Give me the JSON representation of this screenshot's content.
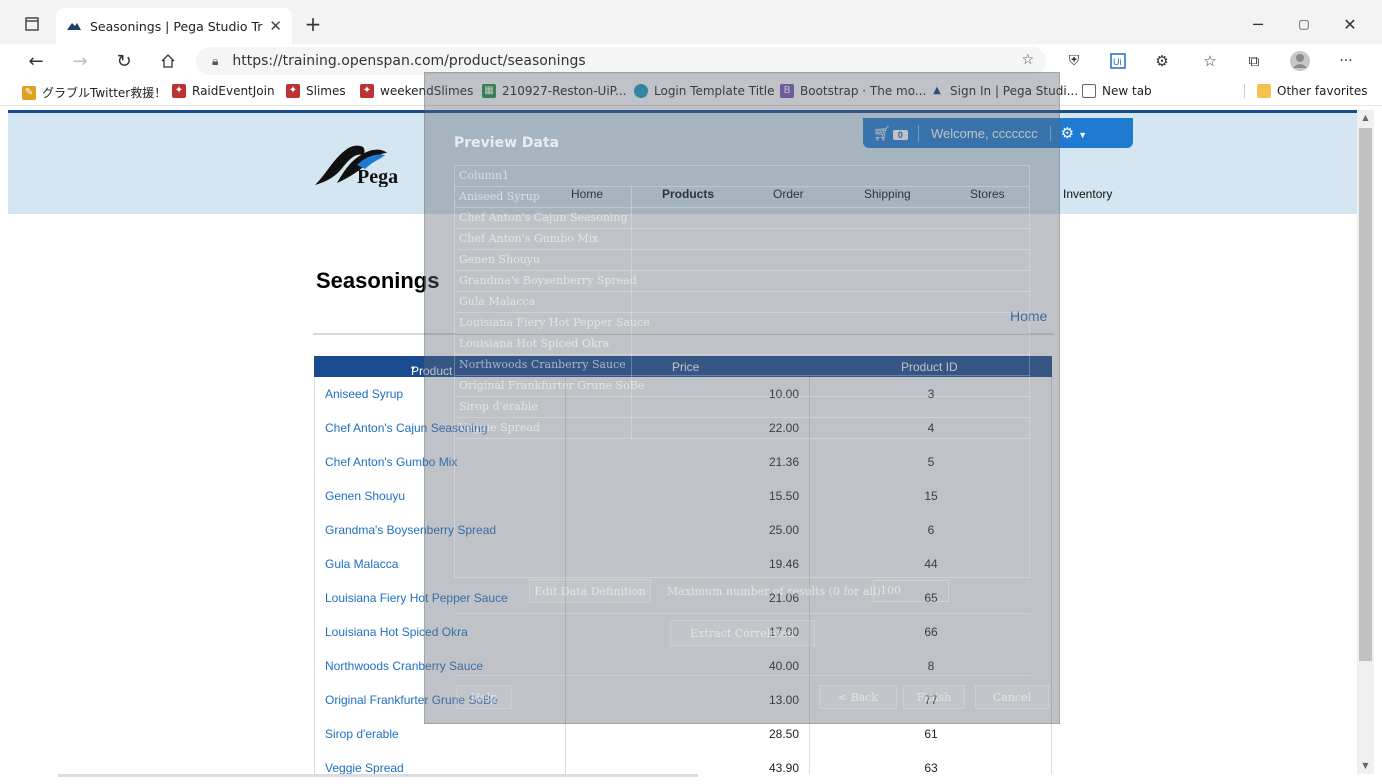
{
  "browser": {
    "tab_title": "Seasonings | Pega Studio Training",
    "url": "https://training.openspan.com/product/seasonings",
    "favorites": [
      {
        "label": "グラブルTwitter救援！",
        "icon": "pencil-icon",
        "color": "#e0a020"
      },
      {
        "label": "RaidEventJoin",
        "icon": "raid-icon",
        "color": "#b33"
      },
      {
        "label": "Slimes",
        "icon": "raid-icon",
        "color": "#b33"
      },
      {
        "label": "weekendSlimes",
        "icon": "raid-icon",
        "color": "#b33"
      },
      {
        "label": "210927-Reston-UiP...",
        "icon": "sheets-icon",
        "color": "#1e8e3e"
      },
      {
        "label": "Login Template Title",
        "icon": "salesforce-icon",
        "color": "#1798c1"
      },
      {
        "label": "Bootstrap · The mo...",
        "icon": "bootstrap-icon",
        "color": "#7952b3"
      },
      {
        "label": "Sign In | Pega Studi...",
        "icon": "pega-icon",
        "color": "#1d3d6b"
      },
      {
        "label": "New tab",
        "icon": "page-icon",
        "color": "#555"
      }
    ],
    "other_favorites": "Other favorites"
  },
  "site": {
    "brand": "Pega",
    "nav": [
      "Home",
      "Products",
      "Order",
      "Shipping",
      "Stores",
      "Inventory"
    ],
    "active_nav": "Products",
    "cart_count": "0",
    "welcome": "Welcome, ccccccc"
  },
  "main": {
    "title": "Seasonings",
    "home_link": "Home",
    "columns": [
      "Product",
      "Price",
      "Product ID"
    ],
    "rows": [
      {
        "name": "Aniseed Syrup",
        "price": "10.00",
        "id": "3"
      },
      {
        "name": "Chef Anton's Cajun Seasoning",
        "price": "22.00",
        "id": "4"
      },
      {
        "name": "Chef Anton's Gumbo Mix",
        "price": "21.36",
        "id": "5"
      },
      {
        "name": "Genen Shouyu",
        "price": "15.50",
        "id": "15"
      },
      {
        "name": "Grandma's Boysenberry Spread",
        "price": "25.00",
        "id": "6"
      },
      {
        "name": "Gula Malacca",
        "price": "19.46",
        "id": "44"
      },
      {
        "name": "Louisiana Fiery Hot Pepper Sauce",
        "price": "21.06",
        "id": "65"
      },
      {
        "name": "Louisiana Hot Spiced Okra",
        "price": "17.00",
        "id": "66"
      },
      {
        "name": "Northwoods Cranberry Sauce",
        "price": "40.00",
        "id": "8"
      },
      {
        "name": "Original Frankfurter Grune SoBe",
        "price": "13.00",
        "id": "77"
      },
      {
        "name": "Sirop d'erable",
        "price": "28.50",
        "id": "61"
      },
      {
        "name": "Veggie Spread",
        "price": "43.90",
        "id": "63"
      }
    ]
  },
  "dialog": {
    "title": "Preview Data",
    "column_header": "Column1",
    "rows": [
      "Aniseed Syrup",
      "Chef Anton's Cajun Seasoning",
      "Chef Anton's Gumbo Mix",
      "Genen Shouyu",
      "Grandma's Boysenberry Spread",
      "Gula Malacca",
      "Louisiana Fiery Hot Pepper Sauce",
      "Louisiana Hot Spiced Okra",
      "Northwoods Cranberry Sauce",
      "Original Frankfurter Grune SoBe",
      "Sirop d'erable",
      "Veggie Spread"
    ],
    "edit_button": "Edit Data Definition",
    "max_label": "Maximum number of results (0 for all)",
    "max_value": "100",
    "extract_button": "Extract Correlated",
    "help_button": "Help",
    "back_button": "< Back",
    "finish_button": "Finish",
    "cancel_button": "Cancel"
  }
}
